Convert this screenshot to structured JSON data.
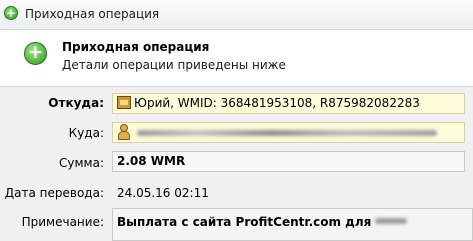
{
  "window": {
    "title": "Приходная операция"
  },
  "header": {
    "title": "Приходная операция",
    "subtitle": "Детали операции приведены ниже"
  },
  "fields": {
    "from": {
      "label": "Откуда:",
      "value": "Юрий, WMID: 368481953108, R875982082283"
    },
    "to": {
      "label": "Куда:"
    },
    "amount": {
      "label": "Сумма:",
      "value": "2.08 WMR"
    },
    "date": {
      "label": "Дата перевода:",
      "value": "24.05.16 02:11"
    },
    "note": {
      "label": "Примечание:",
      "value": "Выплата с сайта ProfitCentr.com для"
    }
  },
  "icons": {
    "title": "plus-circle-icon",
    "header": "plus-circle-icon",
    "from": "wallet-icon",
    "to": "person-icon"
  },
  "colors": {
    "accent_green": "#2f9e1e",
    "field_highlight": "#fefbd8"
  }
}
